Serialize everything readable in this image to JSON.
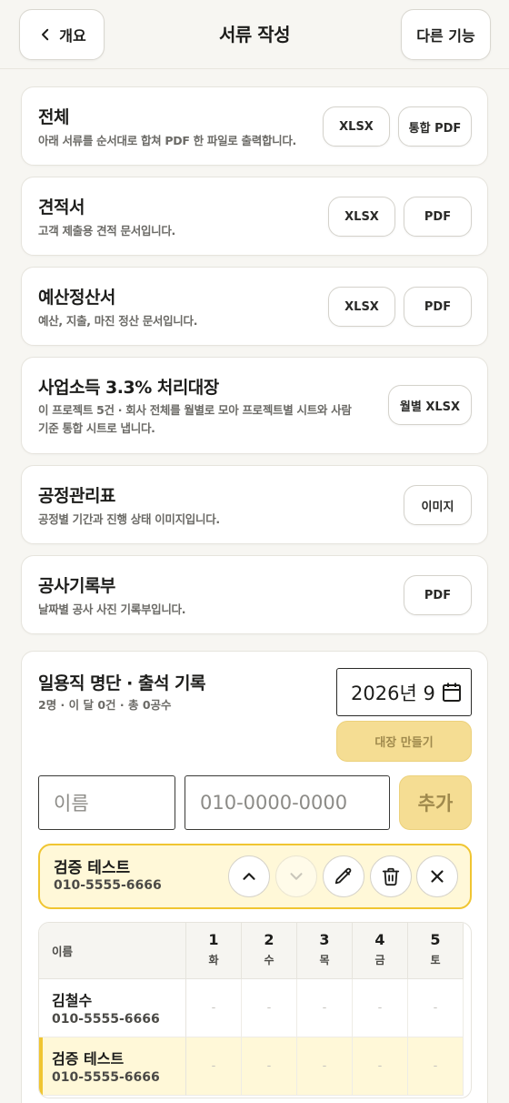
{
  "header": {
    "back_label": "개요",
    "title": "서류 작성",
    "more_label": "다른 기능"
  },
  "documents": [
    {
      "title": "전체",
      "desc": "아래 서류를 순서대로 합쳐 PDF 한 파일로 출력합니다.",
      "buttons": [
        "XLSX",
        "통합 PDF"
      ]
    },
    {
      "title": "견적서",
      "desc": "고객 제출용 견적 문서입니다.",
      "buttons": [
        "XLSX",
        "PDF"
      ]
    },
    {
      "title": "예산정산서",
      "desc": "예산, 지출, 마진 정산 문서입니다.",
      "buttons": [
        "XLSX",
        "PDF"
      ]
    },
    {
      "title": "사업소득 3.3% 처리대장",
      "desc_line1": "이 프로젝트 5건 · 회사 전체를 월별로 모아 프로젝트별 시트와 사람",
      "desc_line2": "기준 통합 시트로 냅니다.",
      "buttons": [
        "월별 XLSX"
      ]
    },
    {
      "title": "공정관리표",
      "desc": "공정별 기간과 진행 상태 이미지입니다.",
      "buttons": [
        "이미지"
      ]
    },
    {
      "title": "공사기록부",
      "desc": "날짜별 공사 사진 기록부입니다.",
      "buttons": [
        "PDF"
      ]
    }
  ],
  "attendance": {
    "title": "일용직 명단 · 출석 기록",
    "summary": "2명 · 이 달 0건 · 총 0공수",
    "date_value": "2026년 9",
    "make_ledger_label": "대장 만들기",
    "name_placeholder": "이름",
    "phone_placeholder": "010-0000-0000",
    "add_label": "추가",
    "selected": {
      "name": "검증 테스트",
      "phone": "010-5555-6666"
    },
    "table": {
      "name_header": "이름",
      "days": [
        {
          "num": "1",
          "weekday": "화"
        },
        {
          "num": "2",
          "weekday": "수"
        },
        {
          "num": "3",
          "weekday": "목"
        },
        {
          "num": "4",
          "weekday": "금"
        },
        {
          "num": "5",
          "weekday": "토"
        }
      ],
      "rows": [
        {
          "name": "김철수",
          "phone": "010-5555-6666",
          "marks": [
            "-",
            "-",
            "-",
            "-",
            "-"
          ]
        },
        {
          "name": "검증 테스트",
          "phone": "010-5555-6666",
          "marks": [
            "-",
            "-",
            "-",
            "-",
            "-"
          ]
        }
      ]
    }
  },
  "colors": {
    "accent": "#f0c531",
    "accent_soft": "#f5dd93",
    "selected_bg": "#fff8d8"
  }
}
